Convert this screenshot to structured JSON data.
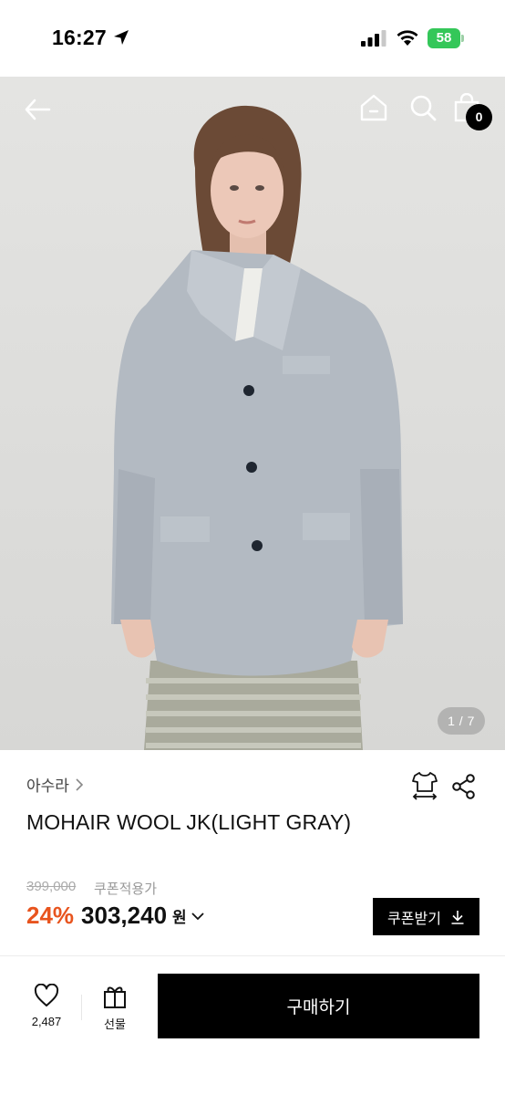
{
  "status_bar": {
    "time": "16:27",
    "battery": "58"
  },
  "header": {
    "cart_count": "0"
  },
  "gallery": {
    "page_indicator": "1 / 7"
  },
  "product": {
    "brand": "아수라",
    "name": "MOHAIR WOOL JK(LIGHT GRAY)",
    "original_price": "399,000",
    "coupon_note": "쿠폰적용가",
    "discount": "24%",
    "sale_price": "303,240",
    "currency": "원"
  },
  "coupon_button": {
    "label": "쿠폰받기"
  },
  "bottom_bar": {
    "like_count": "2,487",
    "gift_label": "선물",
    "buy_label": "구매하기"
  },
  "colors": {
    "discount": "#e8541e",
    "primary_button": "#000000",
    "battery": "#34c759"
  },
  "icons": [
    "location-arrow-icon",
    "signal-icon",
    "wifi-icon",
    "back-arrow-icon",
    "home-icon",
    "search-icon",
    "shopping-bag-icon",
    "chevron-right-icon",
    "size-guide-icon",
    "share-icon",
    "chevron-down-icon",
    "download-icon",
    "heart-icon",
    "gift-icon"
  ]
}
